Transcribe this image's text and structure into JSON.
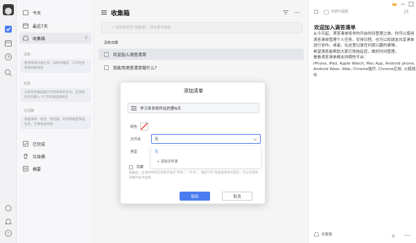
{
  "sidebar": {
    "nav": [
      {
        "label": "今天",
        "count": ""
      },
      {
        "label": "最近7天",
        "count": ""
      },
      {
        "label": "收集箱",
        "count": "2"
      }
    ],
    "sections": [
      {
        "title": "清单",
        "tip": "用清单来分类任务，如好书推荐，工作任务或者购物清单"
      },
      {
        "title": "标签",
        "tip": "以标签的维度展示不同清单的任务。在添加任务时输入\"#\"可快速选择标签"
      },
      {
        "title": "过滤器",
        "tip": "根据清单、标签、优先级、时间等维度筛选任务，方便快速找到"
      }
    ],
    "bottom": [
      {
        "label": "已完成"
      },
      {
        "label": "垃圾桶"
      },
      {
        "label": "摘要"
      }
    ]
  },
  "main": {
    "title": "收集箱",
    "add_placeholder": "+ 添加任务至\"收集箱\"，回车即可保存",
    "group": "没有日期",
    "tasks": [
      {
        "text": "欢迎加入滴答清单"
      },
      {
        "text": "我能用滴答清单做什么？"
      }
    ]
  },
  "dialog": {
    "title": "添加清单",
    "name_value": "学习多多软件站的第N天",
    "color_label": "颜色",
    "folder_label": "文件夹",
    "folder_value": "无",
    "type_label": "类型",
    "dropdown": [
      "无",
      "+ 添加文件夹"
    ],
    "hide_label": "隐藏",
    "note": "隐藏后，此清单中的任务将不会在\"所有\"、\"今天\"、\"最近7天\"等智能清单中显示，可以在我的隐藏列表中查看。",
    "save": "保存",
    "cancel": "取消"
  },
  "detail": {
    "date_label": "日期与提醒",
    "title": "欢迎加入滴答清单",
    "paragraphs": [
      "从今天起，滴答清单将伴你开启时间管理之旅。你可以使用滴答清单管理个人任务、安排日程，也可以和朋友共享清单进行协作。或者，在这里记录任何感兴趣的事情。",
      "希望滴答能帮助大家打败拖延症，做好时间管理。",
      "看看滴答清单都支持哪些平台：",
      "iPhone, iPad, Apple Watch, Mac App, Android phone, Android Wear, Web, Chrome插件, Chrome应用, 火狐插件"
    ],
    "footer": "收集箱"
  },
  "colors": {
    "accent": "#4a7cf0",
    "rail": "#f2f2f4",
    "sidebar": "#f7f7f9"
  }
}
